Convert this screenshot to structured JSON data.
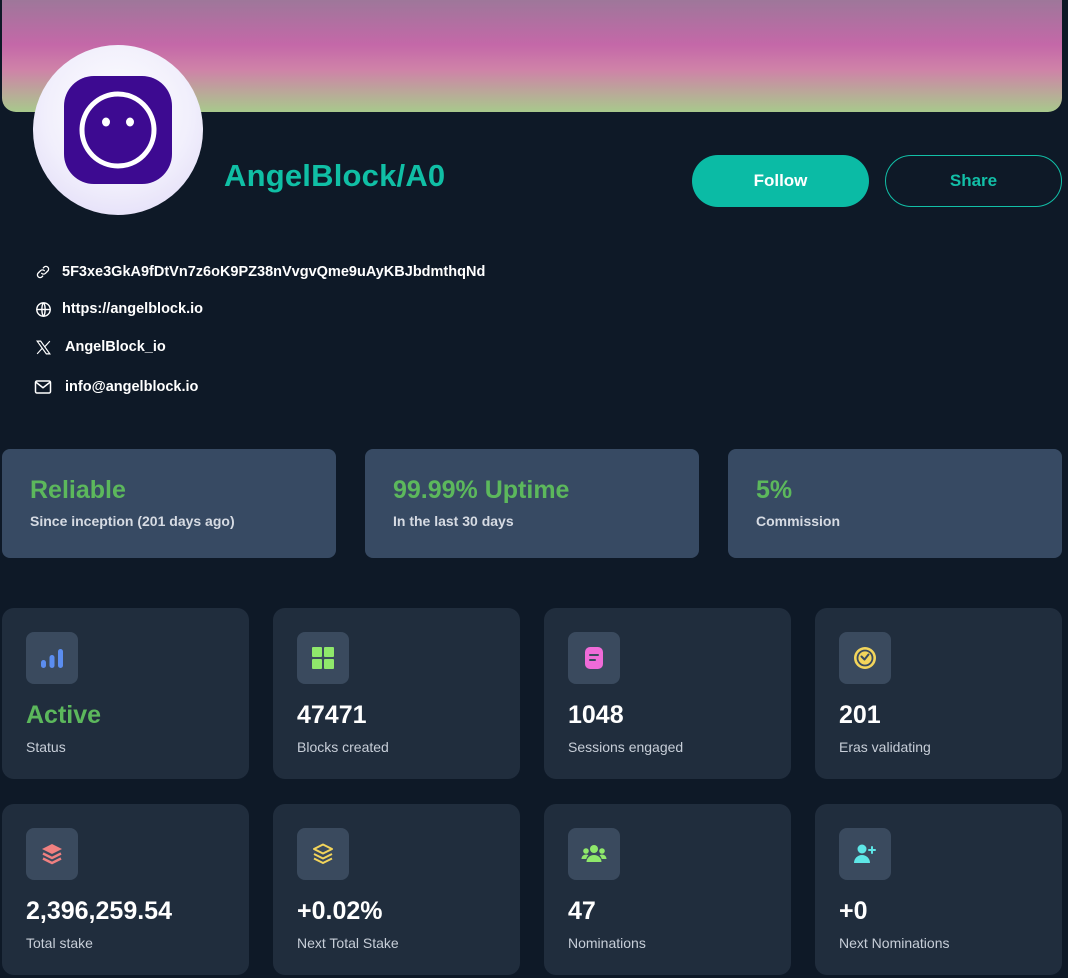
{
  "profile": {
    "name": "AngelBlock/A0",
    "follow_label": "Follow",
    "share_label": "Share"
  },
  "info": {
    "address": "5F3xe3GkA9fDtVn7z6oK9PZ38nVvgvQme9uAyKBJbdmthqNd",
    "website": "https://angelblock.io",
    "twitter": "AngelBlock_io",
    "email": "info@angelblock.io"
  },
  "highlights": [
    {
      "value": "Reliable",
      "label": "Since inception (201 days ago)"
    },
    {
      "value": "99.99% Uptime",
      "label": "In the last 30 days"
    },
    {
      "value": "5%",
      "label": "Commission"
    }
  ],
  "stats": [
    {
      "value": "Active",
      "label": "Status",
      "icon": "bar-chart-icon",
      "icon_color": "#5b8def"
    },
    {
      "value": "47471",
      "label": "Blocks created",
      "icon": "grid-blocks-icon",
      "icon_color": "#8fe86b"
    },
    {
      "value": "1048",
      "label": "Sessions engaged",
      "icon": "document-icon",
      "icon_color": "#f06bd8"
    },
    {
      "value": "201",
      "label": "Eras validating",
      "icon": "clock-icon",
      "icon_color": "#f3d55b"
    },
    {
      "value": "2,396,259.54",
      "label": "Total stake",
      "icon": "layers-icon",
      "icon_color": "#f08080"
    },
    {
      "value": "+0.02%",
      "label": "Next Total Stake",
      "icon": "layers-outline-icon",
      "icon_color": "#f3d55b"
    },
    {
      "value": "47",
      "label": "Nominations",
      "icon": "users-icon",
      "icon_color": "#8fe86b"
    },
    {
      "value": "+0",
      "label": "Next Nominations",
      "icon": "user-plus-icon",
      "icon_color": "#5ee7e7"
    }
  ],
  "colors": {
    "background": "#0e1927",
    "accent": "#0bbba5",
    "success": "#5cb85c",
    "highlight_card": "#374a63",
    "stat_card": "#202d3d"
  }
}
